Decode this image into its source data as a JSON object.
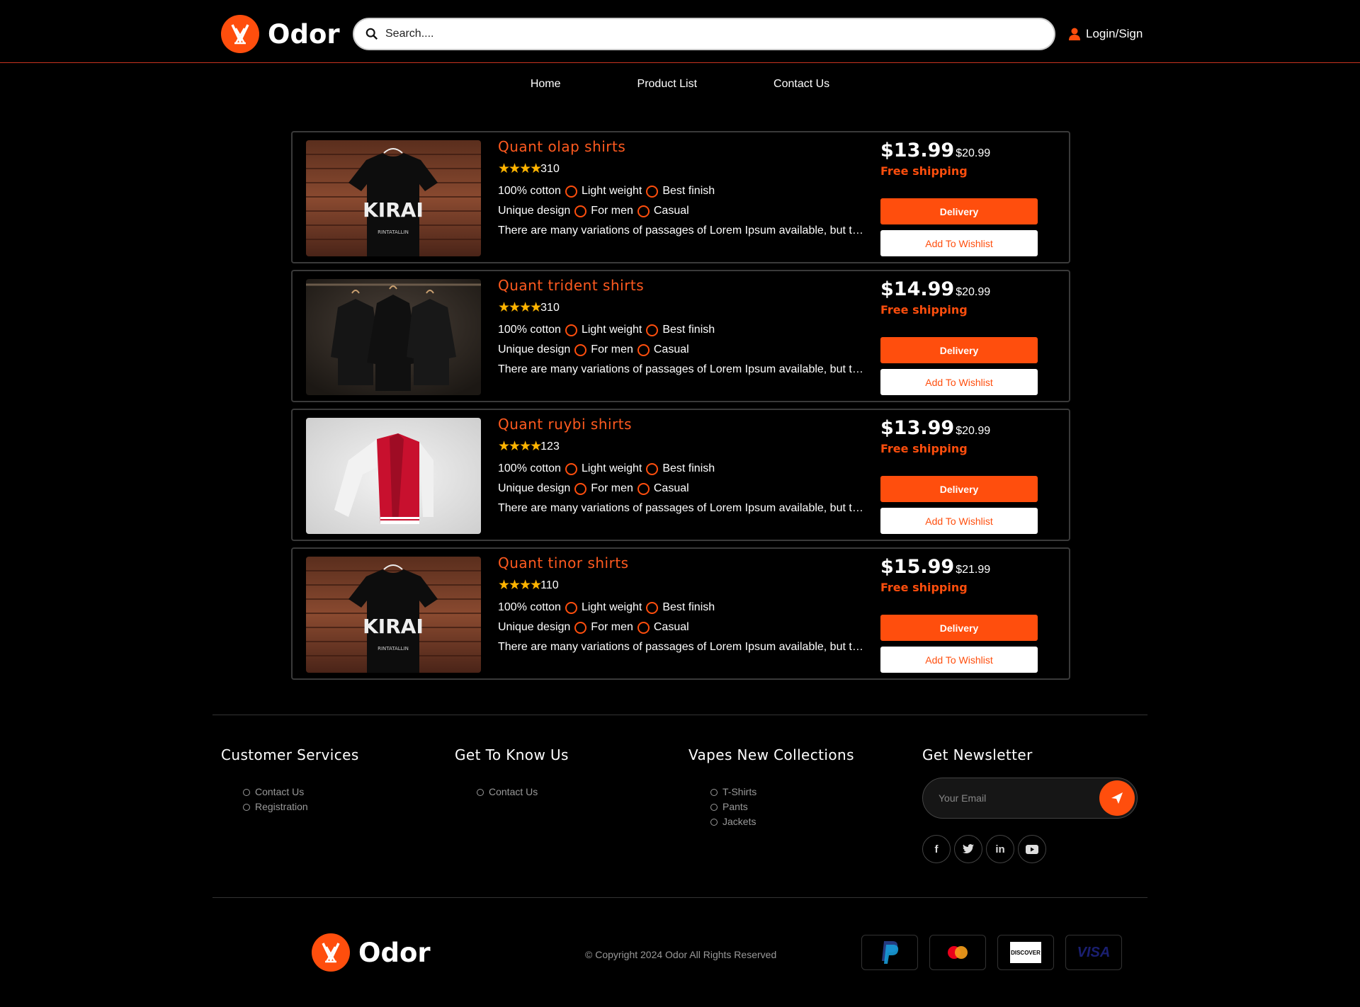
{
  "header": {
    "brand": "Odor",
    "search_placeholder": "Search....",
    "login_label": "Login/Sign"
  },
  "nav": {
    "items": [
      "Home",
      "Product List",
      "Contact Us"
    ]
  },
  "products": [
    {
      "title": "Quant olap shirts",
      "stars": 4,
      "reviews": "310",
      "features": [
        "100% cotton",
        "Light weight",
        "Best finish",
        "Unique design",
        "For men",
        "Casual"
      ],
      "description": "There are many variations of passages of Lorem Ipsum available, but the majority have suffered alteration",
      "price": "$13.99",
      "old_price": "$20.99",
      "shipping": "Free shipping",
      "delivery_label": "Delivery",
      "wishlist_label": "Add To Wishlist",
      "image": "black-tshirt"
    },
    {
      "title": "Quant trident shirts",
      "stars": 4,
      "reviews": "310",
      "features": [
        "100% cotton",
        "Light weight",
        "Best finish",
        "Unique design",
        "For men",
        "Casual"
      ],
      "description": "There are many variations of passages of Lorem Ipsum available, but the majority have suffered alteration",
      "price": "$14.99",
      "old_price": "$20.99",
      "shipping": "Free shipping",
      "delivery_label": "Delivery",
      "wishlist_label": "Add To Wishlist",
      "image": "black-hoodies"
    },
    {
      "title": "Quant ruybi shirts",
      "stars": 4,
      "reviews": "123",
      "features": [
        "100% cotton",
        "Light weight",
        "Best finish",
        "Unique design",
        "For men",
        "Casual"
      ],
      "description": "There are many variations of passages of Lorem Ipsum available, but the majority have suffered alteration",
      "price": "$13.99",
      "old_price": "$20.99",
      "shipping": "Free shipping",
      "delivery_label": "Delivery",
      "wishlist_label": "Add To Wishlist",
      "image": "red-jacket"
    },
    {
      "title": "Quant tinor shirts",
      "stars": 4,
      "reviews": "110",
      "features": [
        "100% cotton",
        "Light weight",
        "Best finish",
        "Unique design",
        "For men",
        "Casual"
      ],
      "description": "There are many variations of passages of Lorem Ipsum available, but the majority have suffered alteration",
      "price": "$15.99",
      "old_price": "$21.99",
      "shipping": "Free shipping",
      "delivery_label": "Delivery",
      "wishlist_label": "Add To Wishlist",
      "image": "black-tshirt"
    }
  ],
  "footer": {
    "columns": [
      {
        "title": "Customer Services",
        "links": [
          "Contact Us",
          "Registration"
        ]
      },
      {
        "title": "Get To Know Us",
        "links": [
          "Contact Us"
        ]
      },
      {
        "title": "Vapes New Collections",
        "links": [
          "T-Shirts",
          "Pants",
          "Jackets"
        ]
      }
    ],
    "newsletter_title": "Get Newsletter",
    "email_placeholder": "Your Email",
    "socials": [
      "facebook-icon",
      "twitter-icon",
      "linkedin-icon",
      "youtube-icon"
    ],
    "brand": "Odor",
    "tshirt_print": "KIRAI",
    "tshirt_print_sub": "RINTATALLIN",
    "copyright": "© Copyright 2024 Odor All Rights Reserved",
    "payments": [
      "paypal",
      "mastercard",
      "discover",
      "visa"
    ],
    "discover_label": "DISCOVER",
    "visa_label": "VISA"
  },
  "colors": {
    "accent": "#ff4e0d",
    "star": "#ffb400",
    "background": "#000000"
  }
}
